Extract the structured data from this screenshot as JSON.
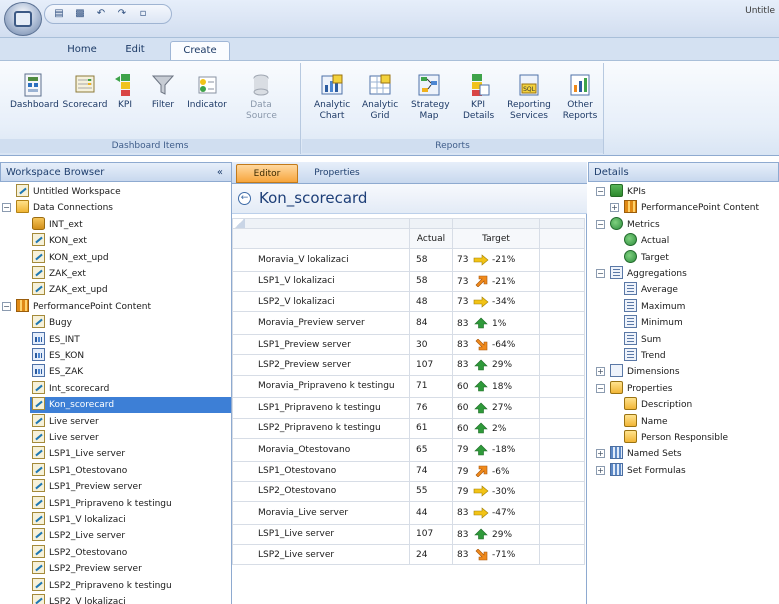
{
  "window": {
    "title": "Untitle"
  },
  "qat": {
    "items": [
      "save-icon",
      "copy-icon",
      "undo-icon",
      "redo-icon",
      "page-icon"
    ]
  },
  "ribbon": {
    "tabs": [
      {
        "label": "Home",
        "active": false
      },
      {
        "label": "Edit",
        "active": false
      },
      {
        "label": "Create",
        "active": true
      }
    ],
    "groups": [
      {
        "label": "Dashboard Items",
        "buttons": [
          {
            "label": "Dashboard",
            "icon": "dashboard-icon",
            "enabled": true
          },
          {
            "label": "Scorecard",
            "icon": "scorecard-icon",
            "enabled": true
          },
          {
            "label": "KPI",
            "icon": "kpi-icon",
            "enabled": true
          },
          {
            "label": "Filter",
            "icon": "filter-icon",
            "enabled": true
          },
          {
            "label": "Indicator",
            "icon": "indicator-icon",
            "enabled": true
          },
          {
            "label": "Data Source",
            "icon": "data-source-icon",
            "enabled": false
          }
        ]
      },
      {
        "label": "Reports",
        "buttons": [
          {
            "label": "Analytic Chart",
            "icon": "analytic-chart-icon",
            "enabled": true
          },
          {
            "label": "Analytic Grid",
            "icon": "analytic-grid-icon",
            "enabled": true
          },
          {
            "label": "Strategy Map",
            "icon": "strategy-map-icon",
            "enabled": true
          },
          {
            "label": "KPI Details",
            "icon": "kpi-details-icon",
            "enabled": true
          },
          {
            "label": "Reporting Services",
            "icon": "reporting-services-icon",
            "enabled": true
          },
          {
            "label": "Other Reports",
            "icon": "other-reports-icon",
            "enabled": true
          }
        ]
      }
    ]
  },
  "workspace": {
    "header": "Workspace Browser",
    "collapse_glyph": "«",
    "items": [
      {
        "label": "Untitled Workspace",
        "level": 0,
        "icon": "workspace-icon",
        "expander": ""
      },
      {
        "label": "Data Connections",
        "level": 0,
        "icon": "folder-icon",
        "expander": "−"
      },
      {
        "label": "INT_ext",
        "level": 1,
        "icon": "database-icon",
        "expander": ""
      },
      {
        "label": "KON_ext",
        "level": 1,
        "icon": "scorecard-icon",
        "expander": ""
      },
      {
        "label": "KON_ext_upd",
        "level": 1,
        "icon": "scorecard-icon",
        "expander": ""
      },
      {
        "label": "ZAK_ext",
        "level": 1,
        "icon": "scorecard-icon",
        "expander": ""
      },
      {
        "label": "ZAK_ext_upd",
        "level": 1,
        "icon": "scorecard-icon",
        "expander": ""
      },
      {
        "label": "PerformancePoint Content",
        "level": 0,
        "icon": "content-icon",
        "expander": "−"
      },
      {
        "label": "Bugy",
        "level": 1,
        "icon": "scorecard-icon",
        "expander": ""
      },
      {
        "label": "ES_INT",
        "level": 1,
        "icon": "report-icon",
        "expander": ""
      },
      {
        "label": "ES_KON",
        "level": 1,
        "icon": "report-icon",
        "expander": ""
      },
      {
        "label": "ES_ZAK",
        "level": 1,
        "icon": "report-icon",
        "expander": ""
      },
      {
        "label": "Int_scorecard",
        "level": 1,
        "icon": "scorecard-icon",
        "expander": ""
      },
      {
        "label": "Kon_scorecard",
        "level": 1,
        "icon": "scorecard-icon",
        "expander": "",
        "selected": true
      },
      {
        "label": "Live server",
        "level": 1,
        "icon": "scorecard-icon",
        "expander": ""
      },
      {
        "label": "Live server",
        "level": 1,
        "icon": "scorecard-icon",
        "expander": ""
      },
      {
        "label": "LSP1_Live server",
        "level": 1,
        "icon": "scorecard-icon",
        "expander": ""
      },
      {
        "label": "LSP1_Otestovano",
        "level": 1,
        "icon": "scorecard-icon",
        "expander": ""
      },
      {
        "label": "LSP1_Preview server",
        "level": 1,
        "icon": "scorecard-icon",
        "expander": ""
      },
      {
        "label": "LSP1_Pripraveno k testingu",
        "level": 1,
        "icon": "scorecard-icon",
        "expander": ""
      },
      {
        "label": "LSP1_V lokalizaci",
        "level": 1,
        "icon": "scorecard-icon",
        "expander": ""
      },
      {
        "label": "LSP2_Live server",
        "level": 1,
        "icon": "scorecard-icon",
        "expander": ""
      },
      {
        "label": "LSP2_Otestovano",
        "level": 1,
        "icon": "scorecard-icon",
        "expander": ""
      },
      {
        "label": "LSP2_Preview server",
        "level": 1,
        "icon": "scorecard-icon",
        "expander": ""
      },
      {
        "label": "LSP2_Pripraveno k testingu",
        "level": 1,
        "icon": "scorecard-icon",
        "expander": ""
      },
      {
        "label": "LSP2_V lokalizaci",
        "level": 1,
        "icon": "scorecard-icon",
        "expander": ""
      }
    ]
  },
  "editor": {
    "tabs": [
      {
        "label": "Editor",
        "active": true
      },
      {
        "label": "Properties",
        "active": false
      }
    ],
    "back_glyph": "←",
    "title": "Kon_scorecard",
    "columns": [
      "Actual",
      "Target"
    ],
    "rows": [
      {
        "label": "Moravia_V lokalizaci",
        "actual": "58",
        "target": "73",
        "indicator": "arrow-right-yellow-icon",
        "change": "-21%"
      },
      {
        "label": "LSP1_V lokalizaci",
        "actual": "58",
        "target": "73",
        "indicator": "arrow-up-right-orange-icon",
        "change": "-21%"
      },
      {
        "label": "LSP2_V lokalizaci",
        "actual": "48",
        "target": "73",
        "indicator": "arrow-right-yellow-icon",
        "change": "-34%"
      },
      {
        "label": "Moravia_Preview server",
        "actual": "84",
        "target": "83",
        "indicator": "arrow-up-green-icon",
        "change": "1%"
      },
      {
        "label": "LSP1_Preview server",
        "actual": "30",
        "target": "83",
        "indicator": "arrow-down-right-orange-icon",
        "change": "-64%"
      },
      {
        "label": "LSP2_Preview server",
        "actual": "107",
        "target": "83",
        "indicator": "arrow-up-green-icon",
        "change": "29%"
      },
      {
        "label": "Moravia_Pripraveno k testingu",
        "actual": "71",
        "target": "60",
        "indicator": "arrow-up-green-icon",
        "change": "18%"
      },
      {
        "label": "LSP1_Pripraveno k testingu",
        "actual": "76",
        "target": "60",
        "indicator": "arrow-up-green-icon",
        "change": "27%"
      },
      {
        "label": "LSP2_Pripraveno k testingu",
        "actual": "61",
        "target": "60",
        "indicator": "arrow-up-green-icon",
        "change": "2%"
      },
      {
        "label": "Moravia_Otestovano",
        "actual": "65",
        "target": "79",
        "indicator": "arrow-up-green-icon",
        "change": "-18%"
      },
      {
        "label": "LSP1_Otestovano",
        "actual": "74",
        "target": "79",
        "indicator": "arrow-up-right-orange-icon",
        "change": "-6%"
      },
      {
        "label": "LSP2_Otestovano",
        "actual": "55",
        "target": "79",
        "indicator": "arrow-right-yellow-icon",
        "change": "-30%"
      },
      {
        "label": "Moravia_Live server",
        "actual": "44",
        "target": "83",
        "indicator": "arrow-right-yellow-icon",
        "change": "-47%"
      },
      {
        "label": "LSP1_Live server",
        "actual": "107",
        "target": "83",
        "indicator": "arrow-up-green-icon",
        "change": "29%"
      },
      {
        "label": "LSP2_Live server",
        "actual": "24",
        "target": "83",
        "indicator": "arrow-down-right-orange-icon",
        "change": "-71%"
      }
    ]
  },
  "details": {
    "header": "Details",
    "items": [
      {
        "label": "KPIs",
        "level": 0,
        "icon": "kpi-icon",
        "expander": "−"
      },
      {
        "label": "PerformancePoint Content",
        "level": 1,
        "icon": "content-icon",
        "expander": "+"
      },
      {
        "label": "Metrics",
        "level": 0,
        "icon": "metric-icon",
        "expander": "−"
      },
      {
        "label": "Actual",
        "level": 1,
        "icon": "metric-icon",
        "expander": ""
      },
      {
        "label": "Target",
        "level": 1,
        "icon": "metric-icon",
        "expander": ""
      },
      {
        "label": "Aggregations",
        "level": 0,
        "icon": "aggregation-icon",
        "expander": "−"
      },
      {
        "label": "Average",
        "level": 1,
        "icon": "aggregation-icon",
        "expander": ""
      },
      {
        "label": "Maximum",
        "level": 1,
        "icon": "aggregation-icon",
        "expander": ""
      },
      {
        "label": "Minimum",
        "level": 1,
        "icon": "aggregation-icon",
        "expander": ""
      },
      {
        "label": "Sum",
        "level": 1,
        "icon": "aggregation-icon",
        "expander": ""
      },
      {
        "label": "Trend",
        "level": 1,
        "icon": "aggregation-icon",
        "expander": ""
      },
      {
        "label": "Dimensions",
        "level": 0,
        "icon": "dimension-icon",
        "expander": "+"
      },
      {
        "label": "Properties",
        "level": 0,
        "icon": "properties-icon",
        "expander": "−"
      },
      {
        "label": "Description",
        "level": 1,
        "icon": "property-icon",
        "expander": ""
      },
      {
        "label": "Name",
        "level": 1,
        "icon": "property-icon",
        "expander": ""
      },
      {
        "label": "Person Responsible",
        "level": 1,
        "icon": "property-icon",
        "expander": ""
      },
      {
        "label": "Named Sets",
        "level": 0,
        "icon": "named-set-icon",
        "expander": "+"
      },
      {
        "label": "Set Formulas",
        "level": 0,
        "icon": "set-formula-icon",
        "expander": "+"
      }
    ]
  },
  "colors": {
    "accent": "#3d7fd6",
    "header_blue": "#1f3f6e",
    "active_tab_orange": "#f7a53d",
    "indicator_green": "#2f9a3a",
    "indicator_yellow": "#f2c316",
    "indicator_orange": "#f08a1c"
  }
}
